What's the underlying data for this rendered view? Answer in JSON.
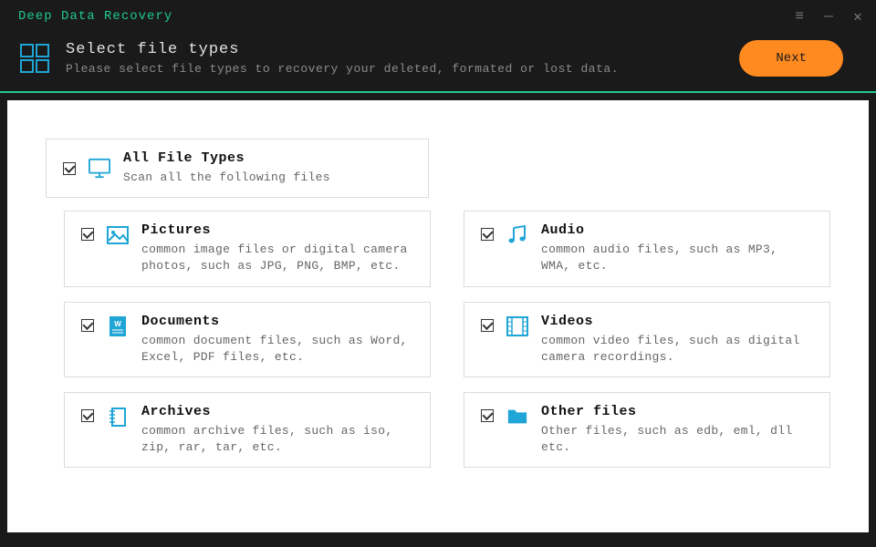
{
  "app": {
    "title": "Deep Data Recovery"
  },
  "header": {
    "title": "Select file types",
    "subtitle": "Please select file types to recovery your deleted, formated or lost data.",
    "next_label": "Next"
  },
  "all_types": {
    "title": "All File Types",
    "desc": "Scan all the following files"
  },
  "types": [
    {
      "id": "pictures",
      "title": "Pictures",
      "desc": "common image files or digital camera photos, such as JPG, PNG, BMP, etc."
    },
    {
      "id": "audio",
      "title": "Audio",
      "desc": "common audio files, such as MP3, WMA, etc."
    },
    {
      "id": "documents",
      "title": "Documents",
      "desc": "common document files, such as Word, Excel, PDF files, etc."
    },
    {
      "id": "videos",
      "title": "Videos",
      "desc": "common video files, such as digital camera recordings."
    },
    {
      "id": "archives",
      "title": "Archives",
      "desc": "common archive files, such as iso, zip, rar, tar, etc."
    },
    {
      "id": "other",
      "title": "Other files",
      "desc": "Other files, such as edb, eml, dll etc."
    }
  ]
}
